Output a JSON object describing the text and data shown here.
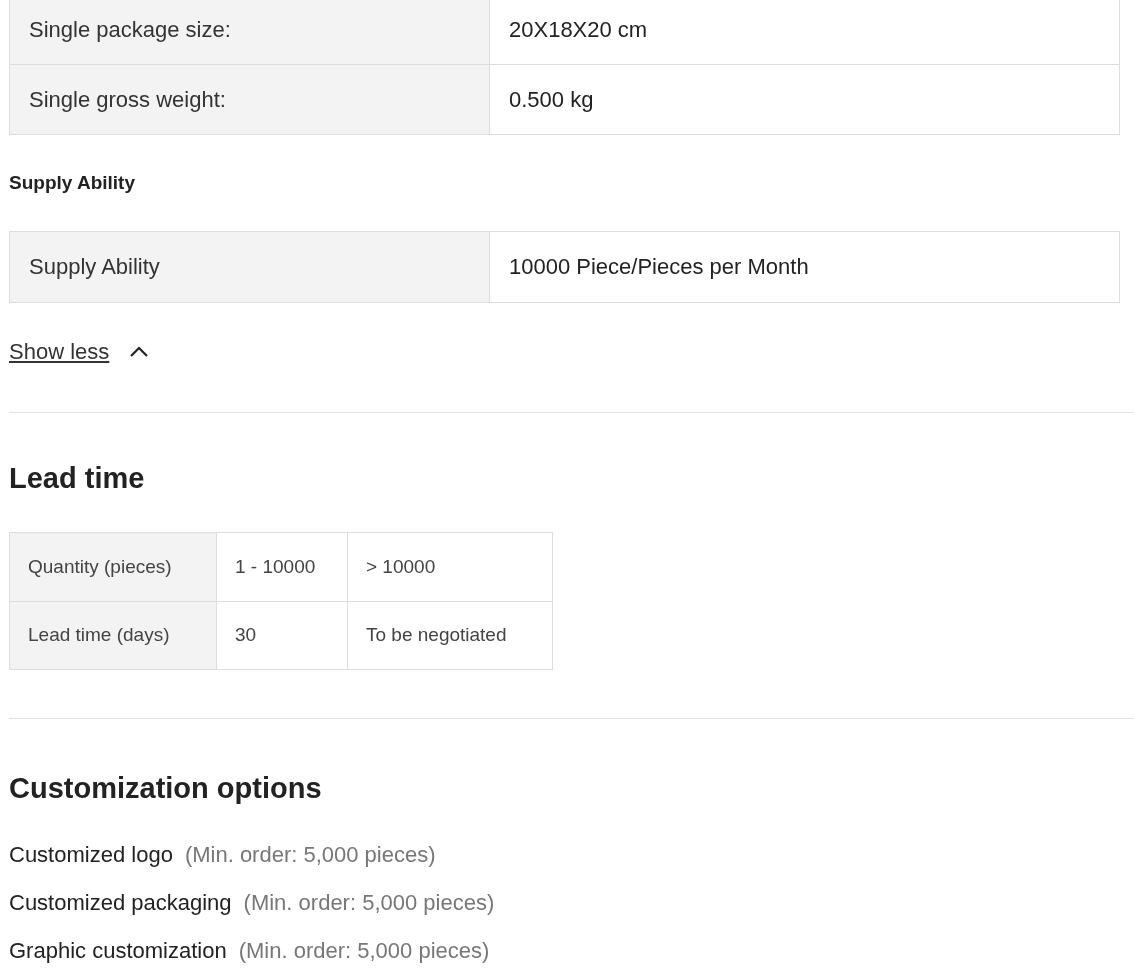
{
  "packaging_table": {
    "rows": [
      {
        "label": "Single package size:",
        "value": "20X18X20 cm"
      },
      {
        "label": "Single gross weight:",
        "value": "0.500 kg"
      }
    ]
  },
  "supply": {
    "heading": "Supply Ability",
    "rows": [
      {
        "label": "Supply Ability",
        "value": "10000 Piece/Pieces per Month"
      }
    ]
  },
  "toggle": {
    "label": "Show less",
    "expanded": true
  },
  "lead_time": {
    "heading": "Lead time",
    "rows": [
      {
        "label": "Quantity (pieces)",
        "cells": [
          "1 - 10000",
          "> 10000"
        ]
      },
      {
        "label": "Lead time (days)",
        "cells": [
          "30",
          "To be negotiated"
        ]
      }
    ]
  },
  "customization": {
    "heading": "Customization options",
    "options": [
      {
        "name": "Customized logo",
        "note": "(Min. order: 5,000 pieces)"
      },
      {
        "name": "Customized packaging",
        "note": "(Min. order: 5,000 pieces)"
      },
      {
        "name": "Graphic customization",
        "note": "(Min. order: 5,000 pieces)"
      }
    ]
  }
}
